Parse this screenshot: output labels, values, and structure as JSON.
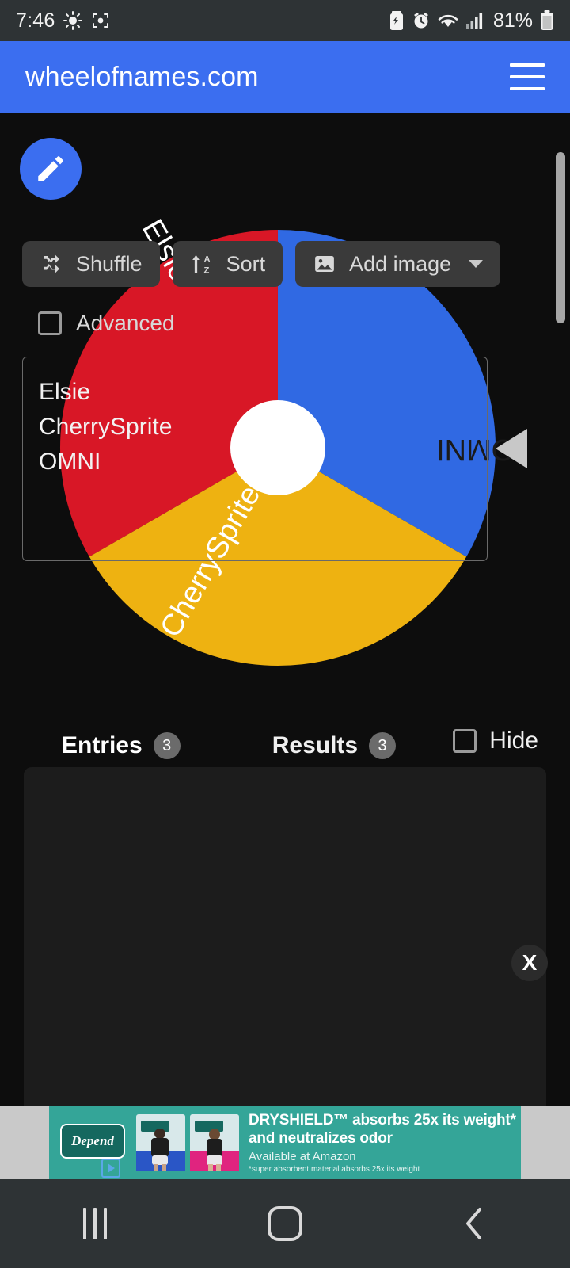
{
  "status_bar": {
    "time": "7:46",
    "battery_percent": "81%",
    "icons_left": [
      "brightness-icon",
      "screen-capture-icon"
    ],
    "icons_right": [
      "battery-saver-icon",
      "alarm-icon",
      "wifi-icon",
      "cellular-signal-icon",
      "battery-icon"
    ]
  },
  "app_bar": {
    "title": "wheelofnames.com",
    "menu_icon": "hamburger-menu-icon",
    "background_color": "#3b6ef0"
  },
  "fab": {
    "icon": "pencil-edit-icon",
    "color": "#3b6ef0"
  },
  "chart_data": {
    "type": "pie",
    "title": "",
    "categories": [
      "CherrySprite",
      "Elsie",
      "OMNI"
    ],
    "values": [
      1,
      1,
      1
    ],
    "labels": [
      "CherrySprite",
      "Elsie",
      "OMNI"
    ],
    "colors": [
      "#d81726",
      "#3069e3",
      "#eeb211"
    ],
    "text_colors": [
      "#ffffff",
      "#ffffff",
      "#1a1a1a"
    ],
    "start_angles_deg": [
      -90,
      30,
      150
    ],
    "sweep_deg": 120,
    "hub_color": "#ffffff",
    "pointer_color": "#c8c8c8",
    "pointer_position": "right",
    "legend": "none",
    "grid": false
  },
  "tabs": [
    {
      "label": "Entries",
      "badge": "3",
      "active": true
    },
    {
      "label": "Results",
      "badge": "3",
      "active": false
    }
  ],
  "hide_toggle": {
    "label": "Hide",
    "checked": false
  },
  "toolbar": {
    "shuffle_label": "Shuffle",
    "shuffle_icon": "shuffle-icon",
    "sort_label": "Sort",
    "sort_icon": "sort-alpha-icon",
    "add_image_label": "Add image",
    "add_image_icon": "image-icon",
    "add_image_chevron": "chevron-down-icon"
  },
  "advanced_toggle": {
    "label": "Advanced",
    "checked": false
  },
  "entries_textarea": {
    "lines": [
      "Elsie",
      "CherrySprite",
      "OMNI"
    ]
  },
  "ad": {
    "close_label": "X",
    "brand": "Depend",
    "headline_line1": "DRYSHIELD™ absorbs 25x its weight*",
    "headline_line2": "and neutralizes odor",
    "subtext": "Available at Amazon",
    "fine_print": "*super absorbent material absorbs 25x its weight",
    "background_color": "#34a598"
  },
  "nav_bar": {
    "recents_icon": "recents-icon",
    "home_icon": "home-icon",
    "back_icon": "back-chevron-icon"
  }
}
